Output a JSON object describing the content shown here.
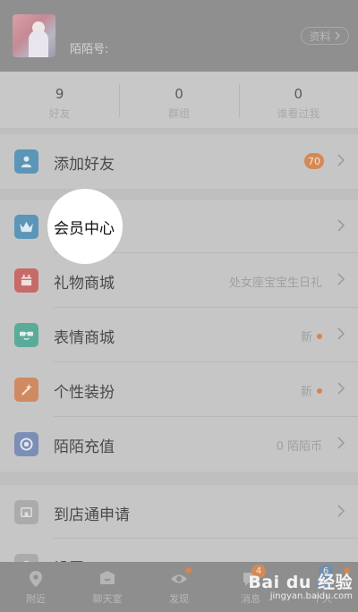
{
  "profile": {
    "momo_id_label": "陌陌号:",
    "profile_button": "资料"
  },
  "stats": [
    {
      "value": "9",
      "label": "好友"
    },
    {
      "value": "0",
      "label": "群组"
    },
    {
      "value": "0",
      "label": "谁看过我"
    }
  ],
  "menu": {
    "add_friend": {
      "label": "添加好友",
      "badge": "70",
      "icon": "person-icon",
      "icon_color": "#5b95b8"
    },
    "vip_center": {
      "label": "会员中心",
      "icon": "crown-icon",
      "icon_color": "#5b95b8"
    },
    "gift_mall": {
      "label": "礼物商城",
      "sub": "处女座宝宝生日礼",
      "icon": "gift-calendar-icon",
      "icon_color": "#c86a67"
    },
    "sticker_mall": {
      "label": "表情商城",
      "sub": "新",
      "icon": "sunglasses-face-icon",
      "icon_color": "#5aab9a"
    },
    "personal_style": {
      "label": "个性装扮",
      "sub": "新",
      "icon": "magic-wand-icon",
      "icon_color": "#cf8a62"
    },
    "recharge": {
      "label": "陌陌充值",
      "sub": "0 陌陌币",
      "icon": "coin-icon",
      "icon_color": "#7b8eb5"
    },
    "store_apply": {
      "label": "到店通申请",
      "icon": "store-icon",
      "icon_color": "#ababab"
    },
    "settings": {
      "label": "设置",
      "icon": "gear-icon"
    }
  },
  "tabs": [
    {
      "label": "附近",
      "icon": "location-pin-icon"
    },
    {
      "label": "聊天室",
      "icon": "chat-room-icon"
    },
    {
      "label": "发现",
      "icon": "eye-icon",
      "dot": true
    },
    {
      "label": "消息",
      "icon": "message-bubble-icon",
      "badge": "4"
    },
    {
      "label": "个人",
      "icon": "person-icon",
      "badge": "6",
      "dot": true
    }
  ],
  "watermark": {
    "brand": "Bai du 经验",
    "url": "jingyan.baidu.com"
  },
  "colors": {
    "accent_orange": "#d48a57"
  }
}
